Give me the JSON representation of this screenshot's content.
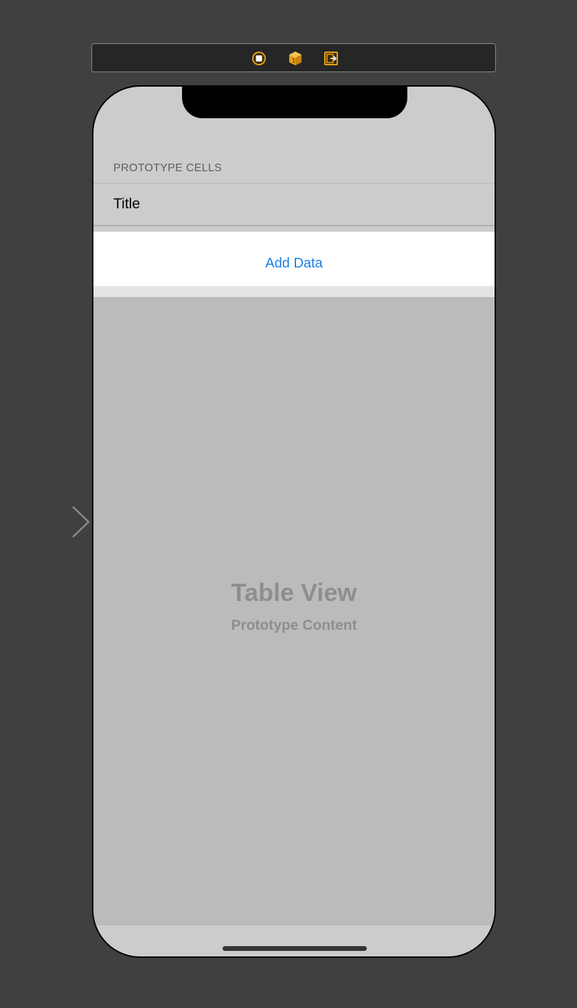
{
  "scene_dock": {
    "icons": [
      {
        "name": "view-controller-icon",
        "color": "#e8a317"
      },
      {
        "name": "first-responder-icon",
        "color": "#e8a317"
      },
      {
        "name": "exit-icon",
        "color": "#e8a317"
      }
    ]
  },
  "table": {
    "section_header": "PROTOTYPE CELLS",
    "prototype_cell_title": "Title",
    "add_data_label": "Add Data",
    "placeholder_title": "Table View",
    "placeholder_subtitle": "Prototype Content"
  },
  "colors": {
    "canvas_background": "#404040",
    "accent_blue": "#1a7ee6",
    "dock_icon_orange": "#e8a317"
  }
}
